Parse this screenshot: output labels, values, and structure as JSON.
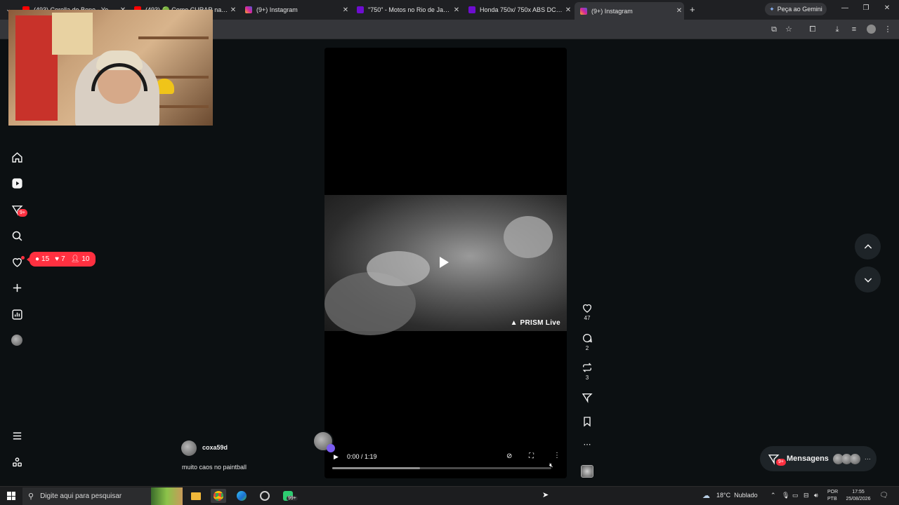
{
  "browser": {
    "tabs": [
      {
        "title": "(493) Corolla do Bone - YouTube",
        "favicon_color": "#ff0000",
        "active": false
      },
      {
        "title": "(493) 🟢 Como CURAR na KICK",
        "favicon_color": "#ff0000",
        "active": false
      },
      {
        "title": "(9+) Instagram",
        "favicon_color": "#d6249f",
        "active": false
      },
      {
        "title": "\"750\" - Motos no Rio de Janeiro",
        "favicon_color": "#6e0dd0",
        "active": false
      },
      {
        "title": "Honda 750x/ 750x ABS DCT 20...",
        "favicon_color": "#6e0dd0",
        "active": false
      },
      {
        "title": "(9+) Instagram",
        "favicon_color": "#d6249f",
        "active": true
      }
    ],
    "gemini_label": "Peça ao Gemini",
    "new_tab": "+"
  },
  "sidebar": {
    "dm_badge": "9+",
    "notifications": {
      "comments": "15",
      "likes": "7",
      "follows": "10"
    }
  },
  "post": {
    "username": "coxa59d",
    "caption": "muito caos no paintball",
    "watermark": "PRISM Live",
    "time": "0:00 / 1:19",
    "progress": 0.4
  },
  "actions": {
    "likes": "47",
    "comments": "2",
    "reposts": "3"
  },
  "messages": {
    "label": "Mensagens",
    "badge": "9+"
  },
  "taskbar": {
    "search_placeholder": "Digite aqui para pesquisar",
    "app_badge": "99+",
    "weather": "18°C  Nublado",
    "lang1": "POR",
    "lang2": "PTB",
    "time": "17:55",
    "date": "25/08/2026"
  },
  "colors": {
    "accent_red": "#ff3040",
    "page_bg": "#0c1012"
  }
}
